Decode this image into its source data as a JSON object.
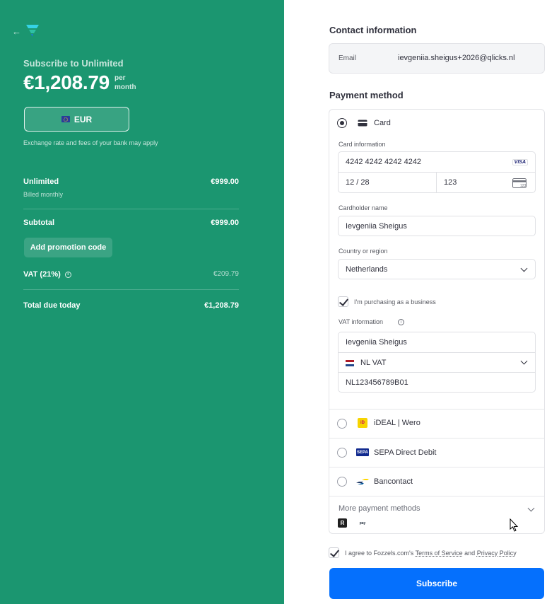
{
  "summary": {
    "back_icon": "arrow-left-icon",
    "subscribe_title": "Subscribe to Unlimited",
    "price": "€1,208.79",
    "per_line1": "per",
    "per_line2": "month",
    "currency_label": "EUR",
    "exchange_note": "Exchange rate and fees of your bank may apply",
    "plan_name": "Unlimited",
    "plan_price": "€999.00",
    "plan_billing": "Billed monthly",
    "subtotal_label": "Subtotal",
    "subtotal_value": "€999.00",
    "promo_label": "Add promotion code",
    "vat_label": "VAT (21%)",
    "vat_value": "€209.79",
    "total_label": "Total due today",
    "total_value": "€1,208.79"
  },
  "contact": {
    "heading": "Contact information",
    "email_label": "Email",
    "email_value": "ievgeniia.sheigus+2026@qlicks.nl"
  },
  "payment": {
    "heading": "Payment method",
    "card_label": "Card",
    "card_info_label": "Card information",
    "card_number": "4242 4242 4242 4242",
    "card_brand": "VISA",
    "expiry": "12 / 28",
    "cvc": "123",
    "cardholder_label": "Cardholder name",
    "cardholder_value": "Ievgeniia Sheigus",
    "country_label": "Country or region",
    "country_value": "Netherlands",
    "business_label": "I'm purchasing as a business",
    "vat_info_label": "VAT information",
    "vat_name": "Ievgeniia Sheigus",
    "vat_type": "NL VAT",
    "vat_number": "NL123456789B01",
    "methods": [
      {
        "label": "iDEAL | Wero",
        "icon": "ideal-icon"
      },
      {
        "label": "SEPA Direct Debit",
        "icon": "sepa-icon"
      },
      {
        "label": "Bancontact",
        "icon": "bancontact-icon"
      }
    ],
    "more_label": "More payment methods",
    "sepa_text": "SEPA"
  },
  "footer": {
    "agree_prefix": "I agree to Fozzels.com's",
    "terms": "Terms of Service",
    "and": "and",
    "privacy": "Privacy Policy",
    "subscribe_button": "Subscribe"
  },
  "colors": {
    "brand_green": "#1b9670",
    "button_blue": "#0570fd"
  }
}
